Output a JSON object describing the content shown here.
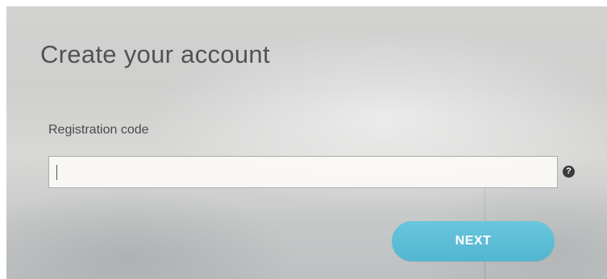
{
  "form": {
    "title": "Create your account",
    "registration_code": {
      "label": "Registration code",
      "value": "",
      "placeholder": ""
    },
    "help_icon": "question-circle-icon",
    "next_label": "NEXT"
  },
  "colors": {
    "accent": "#5bbcd6",
    "text": "#525252",
    "help_icon_bg": "#3a3c3e"
  }
}
